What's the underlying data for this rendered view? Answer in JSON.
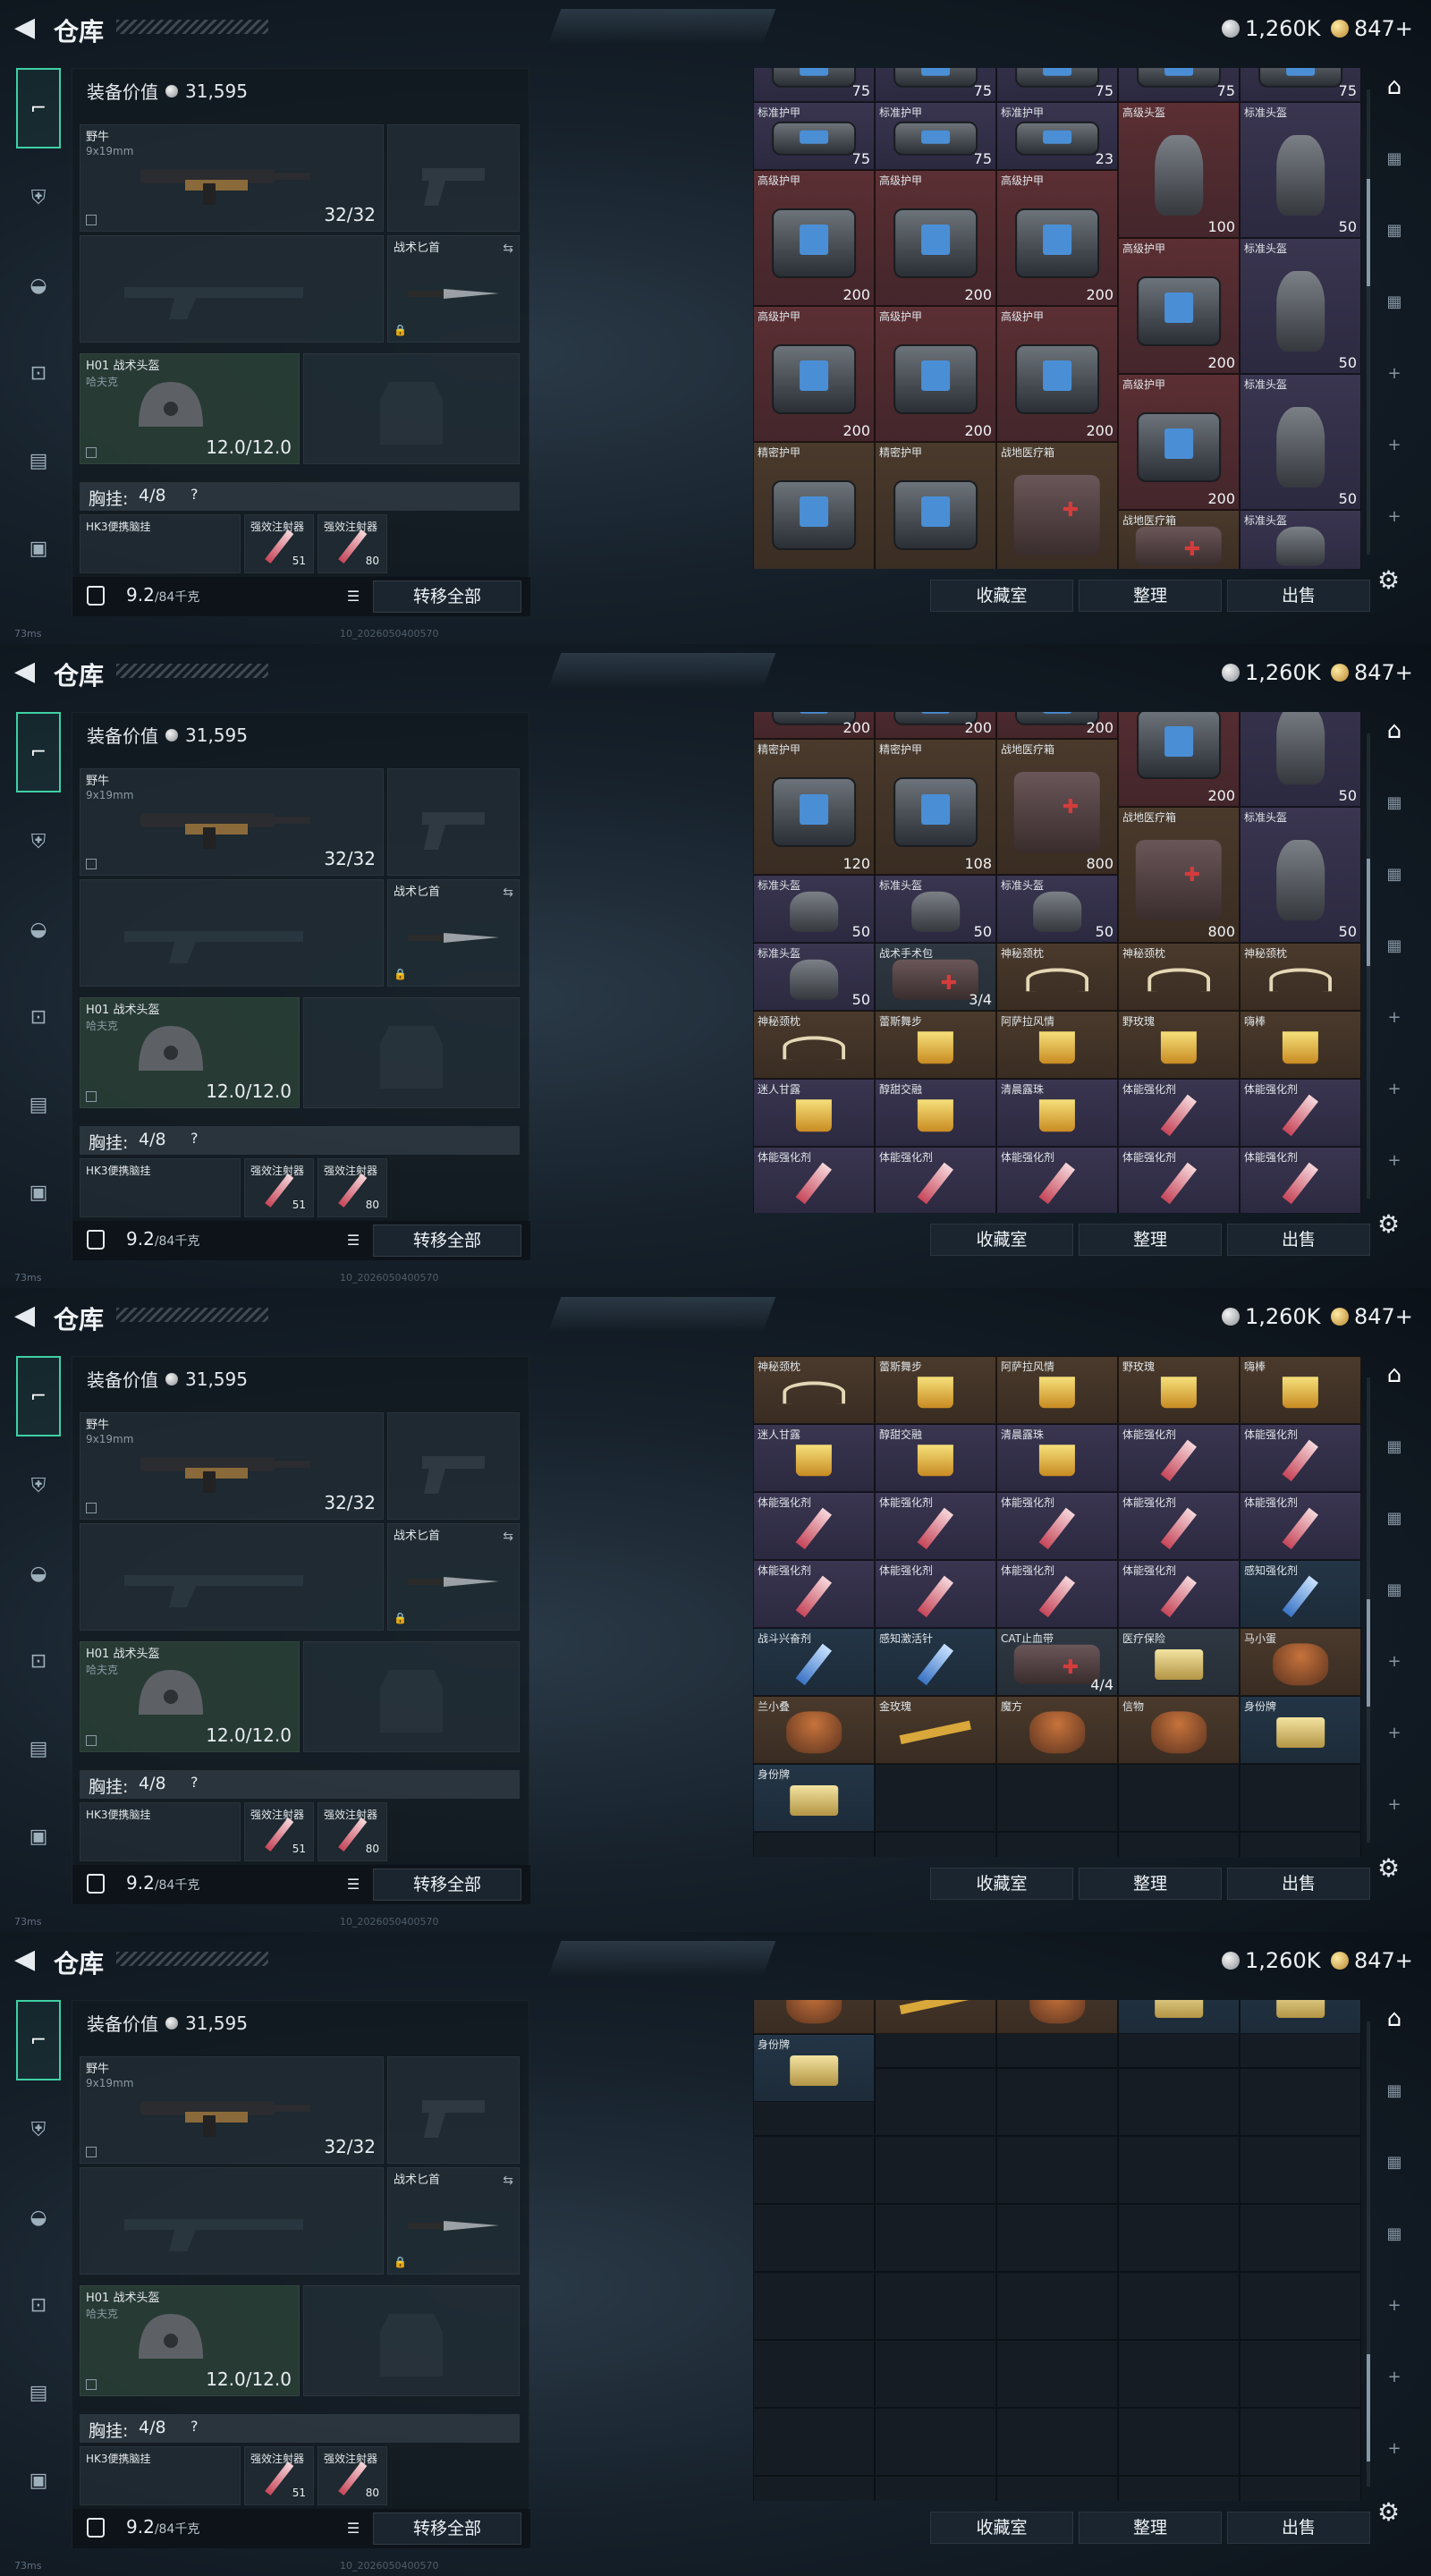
{
  "header": {
    "title": "仓库",
    "silver": "1,260K",
    "gold": "847+"
  },
  "footer": {
    "ping": "73ms",
    "build": "10_2026050400570"
  },
  "loadout": {
    "equip_label": "装备价值",
    "equip_value": "31,595",
    "main_weapon": {
      "name": "野牛",
      "ammo_type": "9x19mm",
      "ammo": "32/32"
    },
    "knife": {
      "name": "战术匕首"
    },
    "helmet": {
      "name": "H01 战术头盔",
      "sub": "哈夫克",
      "durability": "12.0/12.0"
    },
    "rig": {
      "label": "胸挂:",
      "count": "4/8",
      "help": "?"
    },
    "rig_items": [
      {
        "name": "HK3便携脑挂"
      },
      {
        "name": "强效注射器",
        "count": "51"
      },
      {
        "name": "强效注射器",
        "count": "80"
      }
    ],
    "weight": "9.2",
    "weight_cap": "/84千克",
    "move_all": "转移全部"
  },
  "stash_buttons": [
    "收藏室",
    "整理",
    "出售"
  ],
  "stash_views": [
    {
      "thumb": 0.25,
      "cells": [
        {
          "c": 0,
          "r": -0.5,
          "w": 1,
          "h": 1,
          "name": "标准护甲",
          "val": "75",
          "kind": "armor",
          "color": "purple"
        },
        {
          "c": 1,
          "r": -0.5,
          "w": 1,
          "h": 1,
          "name": "标准护甲",
          "val": "75",
          "kind": "armor",
          "color": "purple"
        },
        {
          "c": 2,
          "r": -0.5,
          "w": 1,
          "h": 1,
          "name": "标准护甲",
          "val": "75",
          "kind": "armor",
          "color": "purple"
        },
        {
          "c": 3,
          "r": -0.5,
          "w": 1,
          "h": 1,
          "name": "标准护甲",
          "val": "75",
          "kind": "armor",
          "color": "purple"
        },
        {
          "c": 4,
          "r": -0.5,
          "w": 1,
          "h": 1,
          "name": "标准护甲",
          "val": "75",
          "kind": "armor",
          "color": "purple"
        },
        {
          "c": 0,
          "r": 0.5,
          "w": 1,
          "h": 1,
          "name": "标准护甲",
          "val": "75",
          "kind": "armor",
          "color": "purple"
        },
        {
          "c": 1,
          "r": 0.5,
          "w": 1,
          "h": 1,
          "name": "标准护甲",
          "val": "75",
          "kind": "armor",
          "color": "purple"
        },
        {
          "c": 2,
          "r": 0.5,
          "w": 1,
          "h": 1,
          "name": "标准护甲",
          "val": "23",
          "kind": "armor",
          "color": "purple"
        },
        {
          "c": 3,
          "r": 0.5,
          "w": 1,
          "h": 2,
          "name": "高级头盔",
          "val": "100",
          "kind": "helm",
          "color": "red"
        },
        {
          "c": 4,
          "r": 0.5,
          "w": 1,
          "h": 2,
          "name": "标准头盔",
          "val": "50",
          "kind": "helm",
          "color": "purple"
        },
        {
          "c": 0,
          "r": 1.5,
          "w": 1,
          "h": 2,
          "name": "高级护甲",
          "val": "200",
          "kind": "armor",
          "color": "red"
        },
        {
          "c": 1,
          "r": 1.5,
          "w": 1,
          "h": 2,
          "name": "高级护甲",
          "val": "200",
          "kind": "armor",
          "color": "red"
        },
        {
          "c": 2,
          "r": 1.5,
          "w": 1,
          "h": 2,
          "name": "高级护甲",
          "val": "200",
          "kind": "armor",
          "color": "red"
        },
        {
          "c": 3,
          "r": 2.5,
          "w": 1,
          "h": 2,
          "name": "高级护甲",
          "val": "200",
          "kind": "armor",
          "color": "red"
        },
        {
          "c": 4,
          "r": 2.5,
          "w": 1,
          "h": 2,
          "name": "标准头盔",
          "val": "50",
          "kind": "helm",
          "color": "purple"
        },
        {
          "c": 0,
          "r": 3.5,
          "w": 1,
          "h": 2,
          "name": "高级护甲",
          "val": "200",
          "kind": "armor",
          "color": "red"
        },
        {
          "c": 1,
          "r": 3.5,
          "w": 1,
          "h": 2,
          "name": "高级护甲",
          "val": "200",
          "kind": "armor",
          "color": "red"
        },
        {
          "c": 2,
          "r": 3.5,
          "w": 1,
          "h": 2,
          "name": "高级护甲",
          "val": "200",
          "kind": "armor",
          "color": "red"
        },
        {
          "c": 3,
          "r": 4.5,
          "w": 1,
          "h": 2,
          "name": "高级护甲",
          "val": "200",
          "kind": "armor",
          "color": "red"
        },
        {
          "c": 4,
          "r": 4.5,
          "w": 1,
          "h": 2,
          "name": "标准头盔",
          "val": "50",
          "kind": "helm",
          "color": "purple"
        },
        {
          "c": 0,
          "r": 5.5,
          "w": 1,
          "h": 2,
          "name": "精密护甲",
          "val": "",
          "kind": "armor",
          "color": "brown"
        },
        {
          "c": 1,
          "r": 5.5,
          "w": 1,
          "h": 2,
          "name": "精密护甲",
          "val": "",
          "kind": "armor",
          "color": "brown"
        },
        {
          "c": 2,
          "r": 5.5,
          "w": 1,
          "h": 2,
          "name": "战地医疗箱",
          "val": "",
          "kind": "med",
          "color": "brown"
        },
        {
          "c": 3,
          "r": 6.5,
          "w": 1,
          "h": 1,
          "name": "战地医疗箱",
          "val": "",
          "kind": "med",
          "color": "brown"
        },
        {
          "c": 4,
          "r": 6.5,
          "w": 1,
          "h": 1,
          "name": "标准头盔",
          "val": "",
          "kind": "helm",
          "color": "purple"
        }
      ]
    },
    {
      "thumb": 0.35,
      "cells": [
        {
          "c": 0,
          "r": -0.6,
          "w": 1,
          "h": 1,
          "name": "",
          "val": "200",
          "kind": "armor",
          "color": "red"
        },
        {
          "c": 1,
          "r": -0.6,
          "w": 1,
          "h": 1,
          "name": "",
          "val": "200",
          "kind": "armor",
          "color": "red"
        },
        {
          "c": 2,
          "r": -0.6,
          "w": 1,
          "h": 1,
          "name": "",
          "val": "200",
          "kind": "armor",
          "color": "red"
        },
        {
          "c": 3,
          "r": -0.6,
          "w": 1,
          "h": 2,
          "name": "高级护甲",
          "val": "200",
          "kind": "armor",
          "color": "red"
        },
        {
          "c": 4,
          "r": -0.6,
          "w": 1,
          "h": 2,
          "name": "标准头盔",
          "val": "50",
          "kind": "helm",
          "color": "purple"
        },
        {
          "c": 0,
          "r": 0.4,
          "w": 1,
          "h": 2,
          "name": "精密护甲",
          "val": "120",
          "kind": "armor",
          "color": "brown"
        },
        {
          "c": 1,
          "r": 0.4,
          "w": 1,
          "h": 2,
          "name": "精密护甲",
          "val": "108",
          "kind": "armor",
          "color": "brown"
        },
        {
          "c": 2,
          "r": 0.4,
          "w": 1,
          "h": 2,
          "name": "战地医疗箱",
          "val": "800",
          "kind": "med",
          "color": "brown"
        },
        {
          "c": 3,
          "r": 1.4,
          "w": 1,
          "h": 2,
          "name": "战地医疗箱",
          "val": "800",
          "kind": "med",
          "color": "brown"
        },
        {
          "c": 4,
          "r": 1.4,
          "w": 1,
          "h": 2,
          "name": "标准头盔",
          "val": "50",
          "kind": "helm",
          "color": "purple"
        },
        {
          "c": 0,
          "r": 2.4,
          "w": 1,
          "h": 1,
          "name": "标准头盔",
          "val": "50",
          "kind": "helm",
          "color": "purple"
        },
        {
          "c": 1,
          "r": 2.4,
          "w": 1,
          "h": 1,
          "name": "标准头盔",
          "val": "50",
          "kind": "helm",
          "color": "purple"
        },
        {
          "c": 2,
          "r": 2.4,
          "w": 1,
          "h": 1,
          "name": "标准头盔",
          "val": "50",
          "kind": "helm",
          "color": "purple"
        },
        {
          "c": 0,
          "r": 3.4,
          "w": 1,
          "h": 1,
          "name": "标准头盔",
          "val": "50",
          "kind": "helm",
          "color": "purple"
        },
        {
          "c": 1,
          "r": 3.4,
          "w": 1,
          "h": 1,
          "name": "战术手术包",
          "val": "3/4",
          "kind": "med",
          "color": "gray"
        },
        {
          "c": 2,
          "r": 3.4,
          "w": 1,
          "h": 1,
          "name": "神秘颈枕",
          "val": "",
          "kind": "horn",
          "color": "brown"
        },
        {
          "c": 3,
          "r": 3.4,
          "w": 1,
          "h": 1,
          "name": "神秘颈枕",
          "val": "",
          "kind": "horn",
          "color": "brown"
        },
        {
          "c": 4,
          "r": 3.4,
          "w": 1,
          "h": 1,
          "name": "神秘颈枕",
          "val": "",
          "kind": "horn",
          "color": "brown"
        },
        {
          "c": 0,
          "r": 4.4,
          "w": 1,
          "h": 1,
          "name": "神秘颈枕",
          "val": "",
          "kind": "horn",
          "color": "brown"
        },
        {
          "c": 1,
          "r": 4.4,
          "w": 1,
          "h": 1,
          "name": "蕾斯舞步",
          "val": "",
          "kind": "drink",
          "color": "brown"
        },
        {
          "c": 2,
          "r": 4.4,
          "w": 1,
          "h": 1,
          "name": "阿萨拉风情",
          "val": "",
          "kind": "drink",
          "color": "brown"
        },
        {
          "c": 3,
          "r": 4.4,
          "w": 1,
          "h": 1,
          "name": "野玫瑰",
          "val": "",
          "kind": "drink",
          "color": "brown"
        },
        {
          "c": 4,
          "r": 4.4,
          "w": 1,
          "h": 1,
          "name": "嗨棒",
          "val": "",
          "kind": "drink",
          "color": "brown"
        },
        {
          "c": 0,
          "r": 5.4,
          "w": 1,
          "h": 1,
          "name": "迷人甘露",
          "val": "",
          "kind": "drink",
          "color": "purple"
        },
        {
          "c": 1,
          "r": 5.4,
          "w": 1,
          "h": 1,
          "name": "醇甜交融",
          "val": "",
          "kind": "drink",
          "color": "purple"
        },
        {
          "c": 2,
          "r": 5.4,
          "w": 1,
          "h": 1,
          "name": "清晨露珠",
          "val": "",
          "kind": "drink",
          "color": "purple"
        },
        {
          "c": 3,
          "r": 5.4,
          "w": 1,
          "h": 1,
          "name": "体能强化剂",
          "val": "",
          "kind": "syr",
          "color": "purple"
        },
        {
          "c": 4,
          "r": 5.4,
          "w": 1,
          "h": 1,
          "name": "体能强化剂",
          "val": "",
          "kind": "syr",
          "color": "purple"
        },
        {
          "c": 0,
          "r": 6.4,
          "w": 1,
          "h": 1,
          "name": "体能强化剂",
          "val": "",
          "kind": "syr",
          "color": "purple"
        },
        {
          "c": 1,
          "r": 6.4,
          "w": 1,
          "h": 1,
          "name": "体能强化剂",
          "val": "",
          "kind": "syr",
          "color": "purple"
        },
        {
          "c": 2,
          "r": 6.4,
          "w": 1,
          "h": 1,
          "name": "体能强化剂",
          "val": "",
          "kind": "syr",
          "color": "purple"
        },
        {
          "c": 3,
          "r": 6.4,
          "w": 1,
          "h": 1,
          "name": "体能强化剂",
          "val": "",
          "kind": "syr",
          "color": "purple"
        },
        {
          "c": 4,
          "r": 6.4,
          "w": 1,
          "h": 1,
          "name": "体能强化剂",
          "val": "",
          "kind": "syr",
          "color": "purple"
        }
      ]
    },
    {
      "thumb": 0.62,
      "cells": [
        {
          "c": 0,
          "r": 0,
          "w": 1,
          "h": 1,
          "name": "神秘颈枕",
          "val": "",
          "kind": "horn",
          "color": "brown"
        },
        {
          "c": 1,
          "r": 0,
          "w": 1,
          "h": 1,
          "name": "蕾斯舞步",
          "val": "",
          "kind": "drink",
          "color": "brown"
        },
        {
          "c": 2,
          "r": 0,
          "w": 1,
          "h": 1,
          "name": "阿萨拉风情",
          "val": "",
          "kind": "drink",
          "color": "brown"
        },
        {
          "c": 3,
          "r": 0,
          "w": 1,
          "h": 1,
          "name": "野玫瑰",
          "val": "",
          "kind": "drink",
          "color": "brown"
        },
        {
          "c": 4,
          "r": 0,
          "w": 1,
          "h": 1,
          "name": "嗨棒",
          "val": "",
          "kind": "drink",
          "color": "brown"
        },
        {
          "c": 0,
          "r": 1,
          "w": 1,
          "h": 1,
          "name": "迷人甘露",
          "val": "",
          "kind": "drink",
          "color": "purple"
        },
        {
          "c": 1,
          "r": 1,
          "w": 1,
          "h": 1,
          "name": "醇甜交融",
          "val": "",
          "kind": "drink",
          "color": "purple"
        },
        {
          "c": 2,
          "r": 1,
          "w": 1,
          "h": 1,
          "name": "清晨露珠",
          "val": "",
          "kind": "drink",
          "color": "purple"
        },
        {
          "c": 3,
          "r": 1,
          "w": 1,
          "h": 1,
          "name": "体能强化剂",
          "val": "",
          "kind": "syr",
          "color": "purple"
        },
        {
          "c": 4,
          "r": 1,
          "w": 1,
          "h": 1,
          "name": "体能强化剂",
          "val": "",
          "kind": "syr",
          "color": "purple"
        },
        {
          "c": 0,
          "r": 2,
          "w": 1,
          "h": 1,
          "name": "体能强化剂",
          "val": "",
          "kind": "syr",
          "color": "purple"
        },
        {
          "c": 1,
          "r": 2,
          "w": 1,
          "h": 1,
          "name": "体能强化剂",
          "val": "",
          "kind": "syr",
          "color": "purple"
        },
        {
          "c": 2,
          "r": 2,
          "w": 1,
          "h": 1,
          "name": "体能强化剂",
          "val": "",
          "kind": "syr",
          "color": "purple"
        },
        {
          "c": 3,
          "r": 2,
          "w": 1,
          "h": 1,
          "name": "体能强化剂",
          "val": "",
          "kind": "syr",
          "color": "purple"
        },
        {
          "c": 4,
          "r": 2,
          "w": 1,
          "h": 1,
          "name": "体能强化剂",
          "val": "",
          "kind": "syr",
          "color": "purple"
        },
        {
          "c": 0,
          "r": 3,
          "w": 1,
          "h": 1,
          "name": "体能强化剂",
          "val": "",
          "kind": "syr",
          "color": "purple"
        },
        {
          "c": 1,
          "r": 3,
          "w": 1,
          "h": 1,
          "name": "体能强化剂",
          "val": "",
          "kind": "syr",
          "color": "purple"
        },
        {
          "c": 2,
          "r": 3,
          "w": 1,
          "h": 1,
          "name": "体能强化剂",
          "val": "",
          "kind": "syr",
          "color": "purple"
        },
        {
          "c": 3,
          "r": 3,
          "w": 1,
          "h": 1,
          "name": "体能强化剂",
          "val": "",
          "kind": "syr",
          "color": "purple"
        },
        {
          "c": 4,
          "r": 3,
          "w": 1,
          "h": 1,
          "name": "感知强化剂",
          "val": "",
          "kind": "syrb",
          "color": "blue"
        },
        {
          "c": 0,
          "r": 4,
          "w": 1,
          "h": 1,
          "name": "战斗兴奋剂",
          "val": "",
          "kind": "syrb",
          "color": "blue"
        },
        {
          "c": 1,
          "r": 4,
          "w": 1,
          "h": 1,
          "name": "感知激活针",
          "val": "",
          "kind": "syrb",
          "color": "blue"
        },
        {
          "c": 2,
          "r": 4,
          "w": 1,
          "h": 1,
          "name": "CAT止血带",
          "val": "4/4",
          "kind": "med",
          "color": "gray"
        },
        {
          "c": 3,
          "r": 4,
          "w": 1,
          "h": 1,
          "name": "医疗保险",
          "val": "",
          "kind": "tag",
          "color": "gray"
        },
        {
          "c": 4,
          "r": 4,
          "w": 1,
          "h": 1,
          "name": "马小蛋",
          "val": "",
          "kind": "figure",
          "color": "brown"
        },
        {
          "c": 0,
          "r": 5,
          "w": 1,
          "h": 1,
          "name": "兰小叠",
          "val": "",
          "kind": "figure",
          "color": "brown"
        },
        {
          "c": 1,
          "r": 5,
          "w": 1,
          "h": 1,
          "name": "金玫瑰",
          "val": "",
          "kind": "rose",
          "color": "brown"
        },
        {
          "c": 2,
          "r": 5,
          "w": 1,
          "h": 1,
          "name": "魔方",
          "val": "",
          "kind": "figure",
          "color": "brown"
        },
        {
          "c": 3,
          "r": 5,
          "w": 1,
          "h": 1,
          "name": "信物",
          "val": "",
          "kind": "figure",
          "color": "brown"
        },
        {
          "c": 4,
          "r": 5,
          "w": 1,
          "h": 1,
          "name": "身份牌",
          "val": "",
          "kind": "tag",
          "color": "blue"
        },
        {
          "c": 0,
          "r": 6,
          "w": 1,
          "h": 1,
          "name": "身份牌",
          "val": "",
          "kind": "tag",
          "color": "blue"
        }
      ]
    },
    {
      "thumb": 0.93,
      "cells": [
        {
          "c": 0,
          "r": -0.5,
          "w": 1,
          "h": 1,
          "name": "",
          "val": "",
          "kind": "figure",
          "color": "brown"
        },
        {
          "c": 1,
          "r": -0.5,
          "w": 1,
          "h": 1,
          "name": "",
          "val": "",
          "kind": "rose",
          "color": "brown"
        },
        {
          "c": 2,
          "r": -0.5,
          "w": 1,
          "h": 1,
          "name": "",
          "val": "",
          "kind": "figure",
          "color": "brown"
        },
        {
          "c": 3,
          "r": -0.5,
          "w": 1,
          "h": 1,
          "name": "",
          "val": "",
          "kind": "tag",
          "color": "blue"
        },
        {
          "c": 4,
          "r": -0.5,
          "w": 1,
          "h": 1,
          "name": "",
          "val": "",
          "kind": "tag",
          "color": "blue"
        },
        {
          "c": 0,
          "r": 0.5,
          "w": 1,
          "h": 1,
          "name": "身份牌",
          "val": "",
          "kind": "tag",
          "color": "blue"
        }
      ]
    }
  ]
}
